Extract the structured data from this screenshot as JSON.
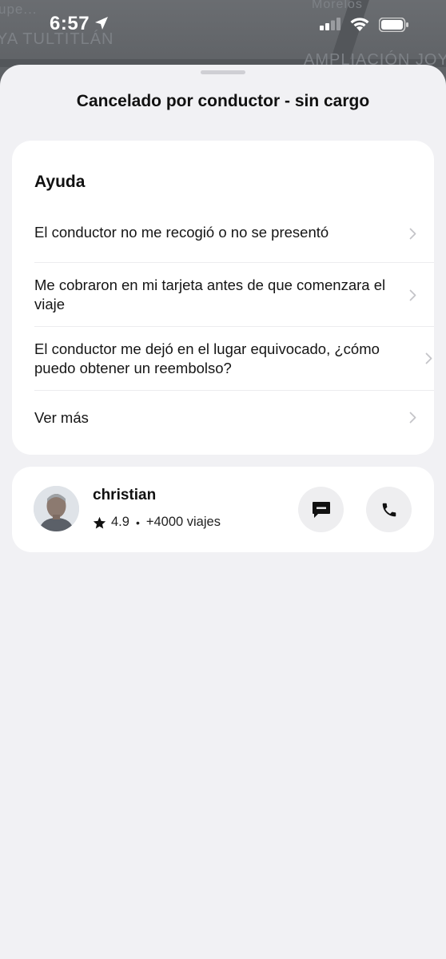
{
  "map": {
    "labels": [
      "upe...",
      "YA TULTITLÁN",
      "Morelos",
      "AMPLIACIÓN JOY"
    ]
  },
  "status_bar": {
    "time": "6:57",
    "icons": [
      "location-arrow-icon",
      "cellular-signal-icon",
      "wifi-icon",
      "battery-icon"
    ]
  },
  "sheet": {
    "title": "Cancelado por conductor - sin cargo"
  },
  "help": {
    "heading": "Ayuda",
    "items": [
      {
        "label": "El conductor no me recogió o no se presentó"
      },
      {
        "label": "Me cobraron en mi tarjeta antes de que comenzara el viaje"
      },
      {
        "label": "El conductor me dejó en el lugar equivocado, ¿cómo puedo obtener un reembolso?"
      },
      {
        "label": "Ver más"
      }
    ]
  },
  "driver": {
    "name": "christian",
    "rating": "4.9",
    "separator": "•",
    "trips": "+4000 viajes",
    "actions": [
      {
        "icon": "message-icon"
      },
      {
        "icon": "phone-icon"
      }
    ]
  }
}
